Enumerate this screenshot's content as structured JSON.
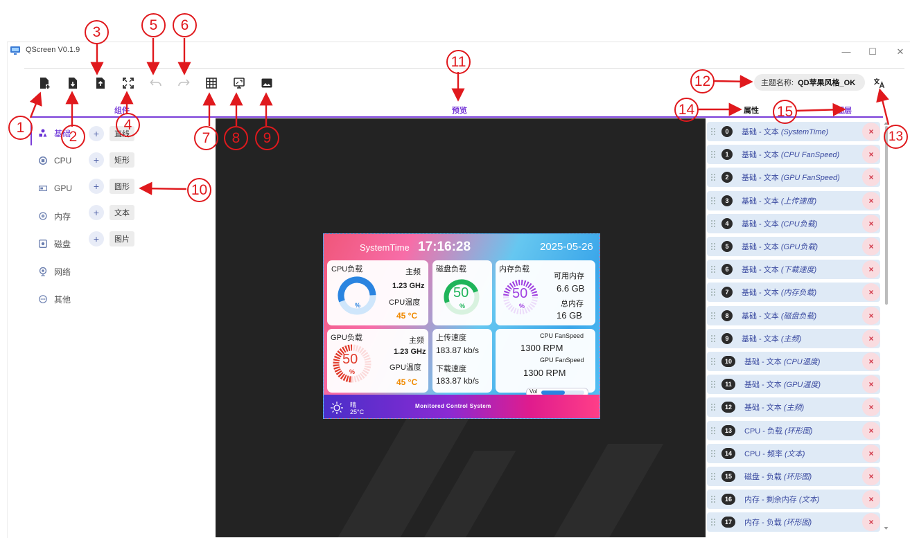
{
  "window": {
    "title": "QScreen V0.1.9",
    "controls": [
      "—",
      "☐",
      "✕"
    ]
  },
  "toolbar": {
    "buttons": [
      {
        "icon": "new-file-icon"
      },
      {
        "icon": "import-file-icon"
      },
      {
        "icon": "export-file-icon"
      },
      {
        "icon": "fullscreen-icon"
      },
      {
        "icon": "undo-icon"
      },
      {
        "icon": "redo-icon"
      },
      {
        "icon": "grid-icon"
      },
      {
        "icon": "screen-icon"
      },
      {
        "icon": "image-icon"
      }
    ],
    "theme_label": "主题名称:",
    "theme_value": "QD苹果风格_OK"
  },
  "sections": {
    "components": "组件",
    "preview": "预览",
    "properties": "属性",
    "layers": "图层"
  },
  "categories": [
    {
      "label": "基础",
      "icon": "basic-shapes-icon",
      "active": true
    },
    {
      "label": "CPU",
      "icon": "cpu-icon"
    },
    {
      "label": "GPU",
      "icon": "gpu-icon"
    },
    {
      "label": "内存",
      "icon": "memory-icon"
    },
    {
      "label": "磁盘",
      "icon": "disk-icon"
    },
    {
      "label": "网络",
      "icon": "network-icon"
    },
    {
      "label": "其他",
      "icon": "more-icon"
    }
  ],
  "components": [
    "直线",
    "矩形",
    "圆形",
    "文本",
    "图片"
  ],
  "add_symbol": "+",
  "preview": {
    "system_time_label": "SystemTime",
    "time": "17:16:28",
    "date": "2025-05-26",
    "cpu": {
      "title": "CPU负载",
      "freq_label": "主频",
      "freq": "1.23 GHz",
      "temp_label": "CPU温度",
      "temp": "45 °C",
      "unit": "%",
      "load_percent": 55
    },
    "disk": {
      "title": "磁盘负载",
      "value": "50",
      "unit": "%"
    },
    "mem": {
      "title": "内存负载",
      "value": "50",
      "unit": "%",
      "avail_label": "可用内存",
      "avail": "6.6 GB",
      "total_label": "总内存",
      "total": "16 GB"
    },
    "gpu": {
      "title": "GPU负载",
      "value": "50",
      "unit": "%",
      "freq_label": "主频",
      "freq": "1.23 GHz",
      "temp_label": "GPU温度",
      "temp": "45 °C"
    },
    "net": {
      "up_label": "上传速度",
      "up": "183.87 kb/s",
      "down_label": "下载速度",
      "down": "183.87 kb/s"
    },
    "fan": {
      "cpu_label": "CPU FanSpeed",
      "cpu": "1300 RPM",
      "gpu_label": "GPU FanSpeed",
      "gpu": "1300 RPM",
      "vol_label": "Vol",
      "vol_level": 0.55
    },
    "weather": {
      "condition": "晴",
      "temp": "25°C"
    },
    "footer": "Monitored Control System"
  },
  "layers": [
    {
      "num": "0",
      "cat": "基础 - 文本",
      "name": "(SystemTime)"
    },
    {
      "num": "1",
      "cat": "基础 - 文本",
      "name": "(CPU FanSpeed)"
    },
    {
      "num": "2",
      "cat": "基础 - 文本",
      "name": "(GPU FanSpeed)"
    },
    {
      "num": "3",
      "cat": "基础 - 文本",
      "name": "(上传速度)"
    },
    {
      "num": "4",
      "cat": "基础 - 文本",
      "name": "(CPU负载)"
    },
    {
      "num": "5",
      "cat": "基础 - 文本",
      "name": "(GPU负载)"
    },
    {
      "num": "6",
      "cat": "基础 - 文本",
      "name": "(下载速度)"
    },
    {
      "num": "7",
      "cat": "基础 - 文本",
      "name": "(内存负载)"
    },
    {
      "num": "8",
      "cat": "基础 - 文本",
      "name": "(磁盘负载)"
    },
    {
      "num": "9",
      "cat": "基础 - 文本",
      "name": "(主频)"
    },
    {
      "num": "10",
      "cat": "基础 - 文本",
      "name": "(CPU温度)"
    },
    {
      "num": "11",
      "cat": "基础 - 文本",
      "name": "(GPU温度)"
    },
    {
      "num": "12",
      "cat": "基础 - 文本",
      "name": "(主频)"
    },
    {
      "num": "13",
      "cat": "CPU - 负载",
      "name": "(环形图)"
    },
    {
      "num": "14",
      "cat": "CPU - 频率",
      "name": "(文本)"
    },
    {
      "num": "15",
      "cat": "磁盘 - 负载",
      "name": "(环形图)"
    },
    {
      "num": "16",
      "cat": "内存 - 剩余内存",
      "name": "(文本)"
    },
    {
      "num": "17",
      "cat": "内存 - 负载",
      "name": "(环形图)"
    }
  ],
  "delete_symbol": "×",
  "callouts": [
    "1",
    "2",
    "3",
    "4",
    "5",
    "6",
    "7",
    "8",
    "9",
    "10",
    "11",
    "12",
    "13",
    "14",
    "15"
  ],
  "colors": {
    "accent": "#7a3dd8",
    "callout": "#e0191d",
    "layer_bg": "#dfeaf6"
  }
}
